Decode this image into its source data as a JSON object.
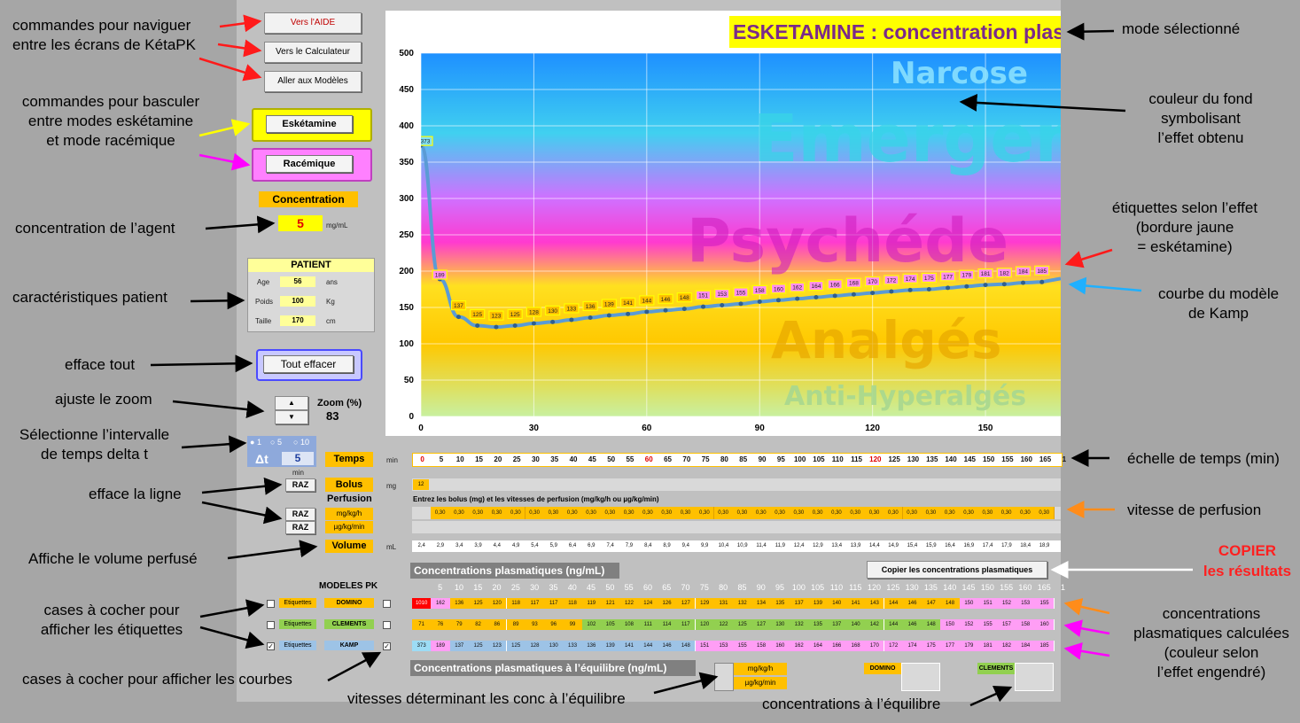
{
  "annotations": {
    "nav_commands": [
      "commandes pour naviguer",
      "entre les écrans de KétaPK"
    ],
    "mode_commands": [
      "commandes pour basculer",
      "entre modes eskétamine",
      "et mode racémique"
    ],
    "agent_concentration": "concentration de l’agent",
    "patient_characteristics": "caractéristiques patient",
    "clear_all": "efface tout",
    "zoom": "ajuste le zoom",
    "delta_t": [
      "Sélectionne l’intervalle",
      "de temps delta t"
    ],
    "clear_line": "efface la ligne",
    "volume": "Affiche le volume perfusé",
    "label_checkboxes": [
      "cases à cocher pour",
      "afficher les étiquettes"
    ],
    "curve_checkboxes": "cases à cocher pour afficher les courbes",
    "selected_mode": "mode sélectionné",
    "background_color": [
      "couleur du fond",
      "symbolisant",
      "l’effet obtenu"
    ],
    "effect_labels": [
      "étiquettes selon l’effet",
      "(bordure jaune",
      "= eskétamine)"
    ],
    "kamp_curve": [
      "courbe du modèle",
      "de Kamp"
    ],
    "time_scale": "échelle de temps (min)",
    "infusion_rate": "vitesse de perfusion",
    "copy_results": [
      "COPIER",
      "les résultats"
    ],
    "calculated_conc": [
      "concentrations",
      "plasmatiques calculées",
      "(couleur selon",
      "l’effet engendré)"
    ],
    "equilibrium_rates": "vitesses déterminant les conc à l’équilibre",
    "equilibrium_conc": "concentrations à l’équilibre"
  },
  "nav": {
    "help": "Vers l'AIDE",
    "calculator": "Vers le Calculateur",
    "models": "Aller aux Modèles"
  },
  "modes": {
    "esketamine": "Eskétamine",
    "racemic": "Racémique"
  },
  "concentration": {
    "label": "Concentration",
    "value": "5",
    "unit": "mg/mL"
  },
  "patient": {
    "title": "PATIENT",
    "fields": [
      {
        "label": "Age",
        "value": "56",
        "unit": "ans"
      },
      {
        "label": "Poids",
        "value": "100",
        "unit": "Kg"
      },
      {
        "label": "Taille",
        "value": "170",
        "unit": "cm"
      }
    ]
  },
  "clear_all_label": "Tout effacer",
  "zoom": {
    "label": "Zoom (%)",
    "value": "83",
    "up": "▲",
    "down": "▼"
  },
  "interval": {
    "options": [
      "1",
      "5",
      "10"
    ],
    "delta": "Δt",
    "value": "5",
    "unit": "min"
  },
  "rows": {
    "time_label": "Temps",
    "time_unit": "min",
    "bolus_label": "Bolus",
    "bolus_unit": "mg",
    "bolus_value": "12",
    "perfusion_label": "Perfusion",
    "perf_unit1": "mg/kg/h",
    "perf_unit2": "µg/kg/min",
    "volume_label": "Volume",
    "volume_unit": "mL",
    "raz": "RAZ",
    "instruction": "Entrez les bolus (mg) et les vitesses de perfusion (mg/kg/h ou µg/kg/min)",
    "perf_value": "0,30"
  },
  "times": [
    "0",
    "5",
    "10",
    "15",
    "20",
    "25",
    "30",
    "35",
    "40",
    "45",
    "50",
    "55",
    "60",
    "65",
    "70",
    "75",
    "80",
    "85",
    "90",
    "95",
    "100",
    "105",
    "110",
    "115",
    "120",
    "125",
    "130",
    "135",
    "140",
    "145",
    "150",
    "155",
    "160",
    "165",
    "1"
  ],
  "volumes": [
    "2,4",
    "2,9",
    "3,4",
    "3,9",
    "4,4",
    "4,9",
    "5,4",
    "5,9",
    "6,4",
    "6,9",
    "7,4",
    "7,9",
    "8,4",
    "8,9",
    "9,4",
    "9,9",
    "10,4",
    "10,9",
    "11,4",
    "11,9",
    "12,4",
    "12,9",
    "13,4",
    "13,9",
    "14,4",
    "14,9",
    "15,4",
    "15,9",
    "16,4",
    "16,9",
    "17,4",
    "17,9",
    "18,4",
    "18,9"
  ],
  "plasma": {
    "title": "Concentrations plasmatiques (ng/mL)",
    "copy_button": "Copier les concentrations plasmatiques",
    "times": [
      "5",
      "10",
      "15",
      "20",
      "25",
      "30",
      "35",
      "40",
      "45",
      "50",
      "55",
      "60",
      "65",
      "70",
      "75",
      "80",
      "85",
      "90",
      "95",
      "100",
      "105",
      "110",
      "115",
      "120",
      "125",
      "130",
      "135",
      "140",
      "145",
      "150",
      "155",
      "160",
      "165",
      "1"
    ],
    "models_title": "MODELES PK",
    "label_tag": "Etiquettes",
    "models": [
      {
        "name": "DOMINO",
        "color": "#ffc000",
        "label_checked": false,
        "curve_checked": false,
        "values": [
          "1010",
          "162",
          "136",
          "125",
          "120",
          "118",
          "117",
          "117",
          "118",
          "119",
          "121",
          "122",
          "124",
          "126",
          "127",
          "129",
          "131",
          "132",
          "134",
          "135",
          "137",
          "139",
          "140",
          "141",
          "143",
          "144",
          "146",
          "147",
          "148",
          "150",
          "151",
          "152",
          "153",
          "155"
        ]
      },
      {
        "name": "CLEMENTS",
        "color": "#92d050",
        "label_checked": false,
        "curve_checked": false,
        "values": [
          "71",
          "76",
          "79",
          "82",
          "86",
          "89",
          "93",
          "96",
          "99",
          "102",
          "105",
          "108",
          "111",
          "114",
          "117",
          "120",
          "122",
          "125",
          "127",
          "130",
          "132",
          "135",
          "137",
          "140",
          "142",
          "144",
          "146",
          "148",
          "150",
          "152",
          "155",
          "157",
          "158",
          "160"
        ]
      },
      {
        "name": "KAMP",
        "color": "#9dc3e6",
        "label_checked": true,
        "curve_checked": true,
        "values": [
          "373",
          "189",
          "137",
          "125",
          "123",
          "125",
          "128",
          "130",
          "133",
          "136",
          "139",
          "141",
          "144",
          "146",
          "148",
          "151",
          "153",
          "155",
          "158",
          "160",
          "162",
          "164",
          "166",
          "168",
          "170",
          "172",
          "174",
          "175",
          "177",
          "179",
          "181",
          "182",
          "184",
          "185"
        ]
      }
    ]
  },
  "equilibrium": {
    "title": "Concentrations plasmatiques à l’équilibre (ng/mL)",
    "unit1": "mg/kg/h",
    "unit2": "µg/kg/min",
    "domino": "DOMINO",
    "clements": "CLEMENTS"
  },
  "chart_data": {
    "type": "line",
    "title": "ESKETAMINE : concentration plasm",
    "xlim": [
      0,
      170
    ],
    "ylim": [
      0,
      500
    ],
    "x_ticks": [
      0,
      30,
      60,
      90,
      120,
      150
    ],
    "y_ticks": [
      0,
      50,
      100,
      150,
      200,
      250,
      300,
      350,
      400,
      450,
      500
    ],
    "zones": [
      "Narcose",
      "Emergen",
      "Psychéde",
      "Analgés",
      "Anti-Hyperalgés"
    ],
    "series": [
      {
        "name": "KAMP",
        "x": [
          0,
          5,
          10,
          15,
          20,
          25,
          30,
          35,
          40,
          45,
          50,
          55,
          60,
          65,
          70,
          75,
          80,
          85,
          90,
          95,
          100,
          105,
          110,
          115,
          120,
          125,
          130,
          135,
          140,
          145,
          150,
          155,
          160,
          165
        ],
        "y": [
          373,
          189,
          137,
          125,
          123,
          125,
          128,
          130,
          133,
          136,
          139,
          141,
          144,
          146,
          148,
          151,
          153,
          155,
          158,
          160,
          162,
          164,
          166,
          168,
          170,
          172,
          174,
          175,
          177,
          179,
          181,
          182,
          184,
          185
        ]
      }
    ],
    "colors": {
      "line": "#5b9bd5",
      "point": "#2f5f8f"
    }
  }
}
